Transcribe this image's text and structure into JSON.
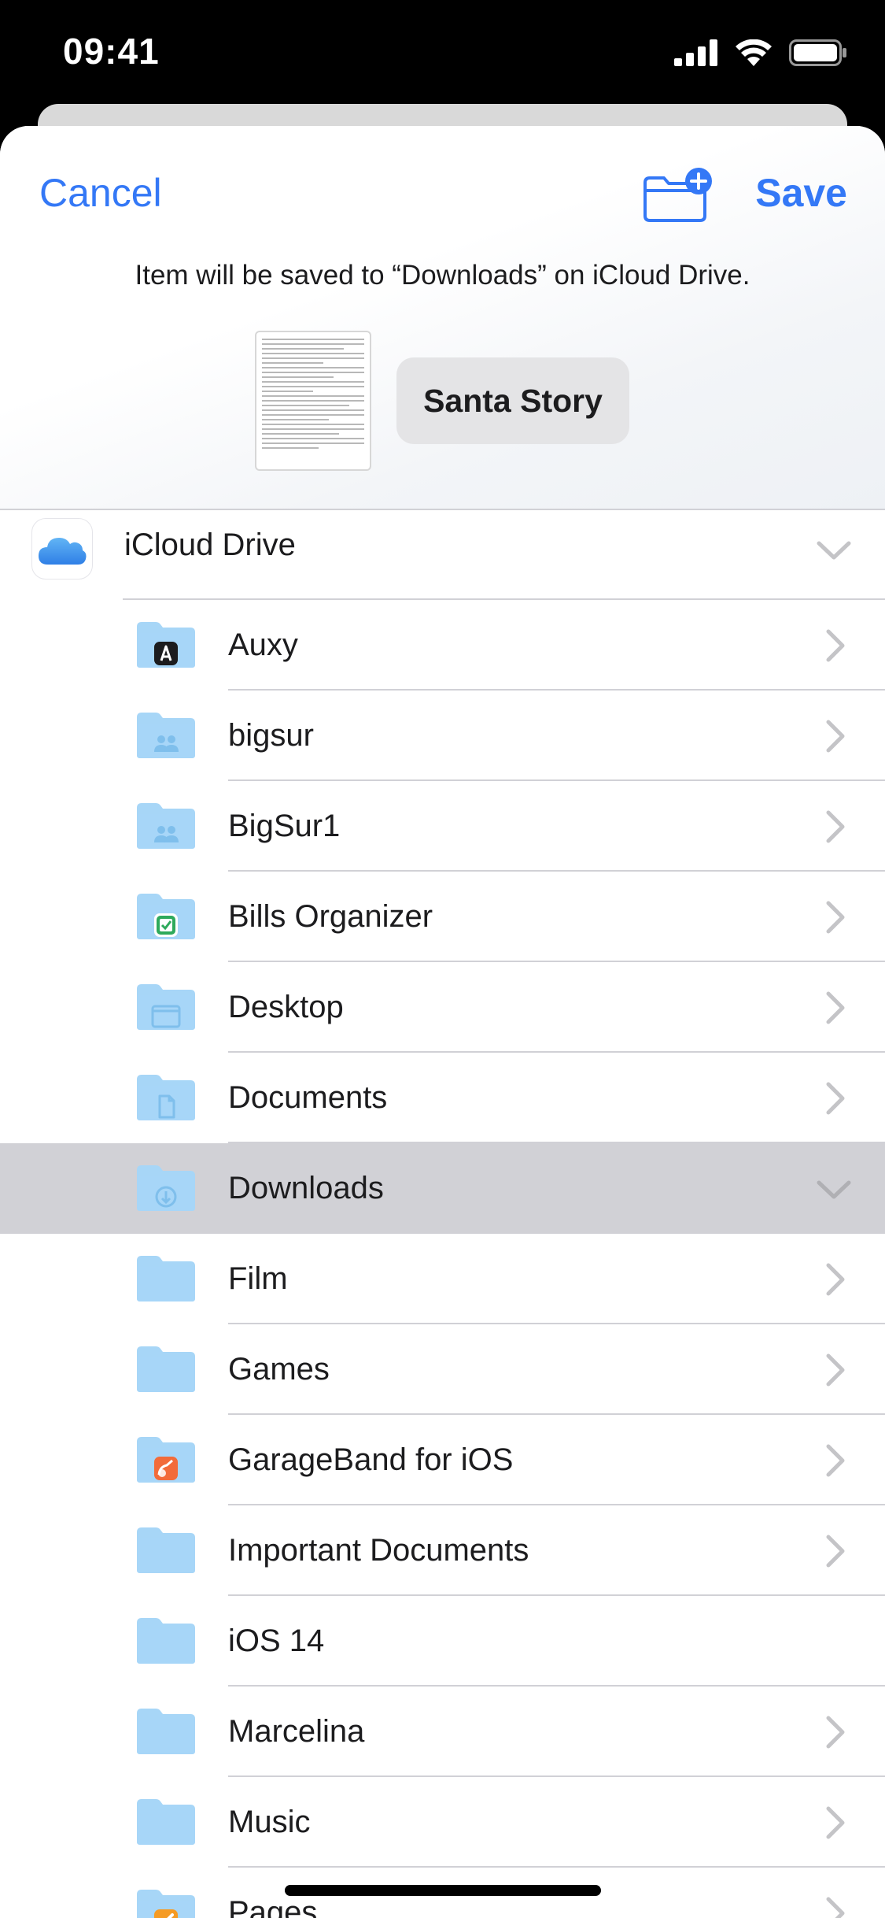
{
  "status": {
    "time": "09:41"
  },
  "nav": {
    "cancel_label": "Cancel",
    "save_label": "Save"
  },
  "save_hint": "Item will be saved to “Downloads” on iCloud Drive.",
  "document": {
    "file_name": "Santa Story"
  },
  "root": {
    "label": "iCloud Drive",
    "expanded": true
  },
  "colors": {
    "accent": "#3478f6",
    "folder": "#a7d6f7",
    "selected_row": "#d1d1d6"
  },
  "folders": [
    {
      "name": "Auxy",
      "badge": "auxy-app-icon",
      "chevron": "right"
    },
    {
      "name": "bigsur",
      "badge": "shared-people-icon",
      "chevron": "right"
    },
    {
      "name": "BigSur1",
      "badge": "shared-people-icon",
      "chevron": "right"
    },
    {
      "name": "Bills Organizer",
      "badge": "bills-organizer-app-icon",
      "chevron": "right"
    },
    {
      "name": "Desktop",
      "badge": "desktop-window-icon",
      "chevron": "right"
    },
    {
      "name": "Documents",
      "badge": "document-page-icon",
      "chevron": "right"
    },
    {
      "name": "Downloads",
      "badge": "download-arrow-icon",
      "chevron": "down",
      "selected": true
    },
    {
      "name": "Film",
      "badge": "",
      "chevron": "right"
    },
    {
      "name": "Games",
      "badge": "",
      "chevron": "right"
    },
    {
      "name": "GarageBand for iOS",
      "badge": "garageband-app-icon",
      "chevron": "right"
    },
    {
      "name": "Important Documents",
      "badge": "",
      "chevron": "right"
    },
    {
      "name": "iOS 14",
      "badge": "",
      "chevron": "none"
    },
    {
      "name": "Marcelina",
      "badge": "",
      "chevron": "right"
    },
    {
      "name": "Music",
      "badge": "",
      "chevron": "right"
    },
    {
      "name": "Pages",
      "badge": "pages-app-icon",
      "chevron": "right"
    }
  ]
}
